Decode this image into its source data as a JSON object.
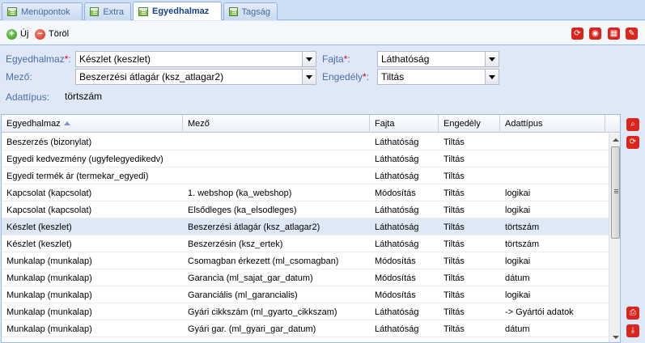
{
  "tabs": [
    {
      "label": "Menüpontok",
      "icon": "grid-icon"
    },
    {
      "label": "Extra",
      "icon": "grid-icon"
    },
    {
      "label": "Egyedhalmaz",
      "icon": "grid-icon"
    },
    {
      "label": "Tagság",
      "icon": "grid-icon"
    }
  ],
  "toolbar": {
    "new_label": "Új",
    "delete_label": "Töröl",
    "new_icon": "plus-circle-icon",
    "delete_icon": "minus-circle-icon",
    "right_icons": [
      "refresh-icon",
      "globe-icon",
      "table-icon",
      "edit-icon"
    ]
  },
  "form": {
    "egyedhalmaz": {
      "label": "Egyedhalmaz",
      "required_mark": "*",
      "value": "Készlet (keszlet)"
    },
    "mezo": {
      "label": "Mező:",
      "value": "Beszerzési átlagár (ksz_atlagar2)"
    },
    "fajta": {
      "label": "Fajta",
      "required_mark": "*",
      "value": "Láthatóság"
    },
    "engedely": {
      "label": "Engedély",
      "required_mark": "*",
      "value": "Tiltás"
    },
    "adattipus": {
      "label": "Adattípus:",
      "value": "törtszám"
    }
  },
  "grid": {
    "columns": [
      "Egyedhalmaz",
      "Mező",
      "Fajta",
      "Engedély",
      "Adattípus"
    ],
    "sorted_column": "Egyedhalmaz",
    "rows": [
      [
        "Beszerzés (bizonylat)",
        "",
        "Láthatóság",
        "Tiltás",
        ""
      ],
      [
        "Egyedi kedvezmény (ugyfelegyedikedv)",
        "",
        "Láthatóság",
        "Tiltás",
        ""
      ],
      [
        "Egyedi termék ár (termekar_egyedi)",
        "",
        "Láthatóság",
        "Tiltás",
        ""
      ],
      [
        "Kapcsolat (kapcsolat)",
        "1. webshop (ka_webshop)",
        "Módosítás",
        "Tiltás",
        "logikai"
      ],
      [
        "Kapcsolat (kapcsolat)",
        "Elsődleges (ka_elsodleges)",
        "Láthatóság",
        "Tiltás",
        "logikai"
      ],
      [
        "Készlet (keszlet)",
        "Beszerzési átlagár (ksz_atlagar2)",
        "Láthatóság",
        "Tiltás",
        "törtszám"
      ],
      [
        "Készlet (keszlet)",
        "Beszerzésin (ksz_ertek)",
        "Láthatóság",
        "Tiltás",
        "törtszám"
      ],
      [
        "Munkalap (munkalap)",
        "Csomagban érkezett (ml_csomagban)",
        "Módosítás",
        "Tiltás",
        "logikai"
      ],
      [
        "Munkalap (munkalap)",
        "Garancia (ml_sajat_gar_datum)",
        "Módosítás",
        "Tiltás",
        "dátum"
      ],
      [
        "Munkalap (munkalap)",
        "Garanciális (ml_garancialis)",
        "Módosítás",
        "Tiltás",
        "logikai"
      ],
      [
        "Munkalap (munkalap)",
        "Gyári cikkszám (ml_gyarto_cikkszam)",
        "Láthatóság",
        "Tiltás",
        "-> Gyártói adatok"
      ],
      [
        "Munkalap (munkalap)",
        "Gyári gar. (ml_gyari_gar_datum)",
        "Láthatóság",
        "Tiltás",
        "dátum"
      ]
    ],
    "selected_row_index": 5
  },
  "side_buttons": [
    "search-icon",
    "refresh-icon",
    "print-icon",
    "download-icon"
  ],
  "colors": {
    "accent_red": "#d9251c",
    "header_blue": "#15428b",
    "label_blue": "#4b6ea3"
  }
}
